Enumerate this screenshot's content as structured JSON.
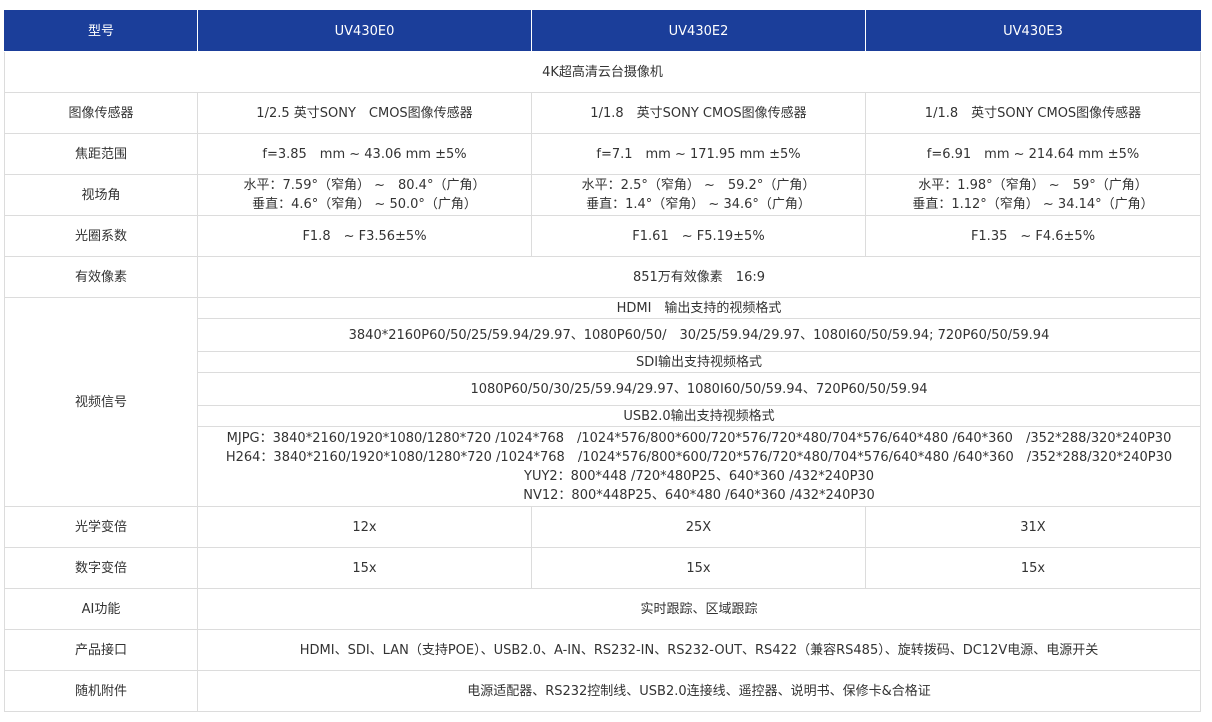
{
  "header": {
    "col_label": "型号",
    "models": [
      "UV430E0",
      "UV430E2",
      "UV430E3"
    ]
  },
  "title_row": "4K超高清云台摄像机",
  "sensor": {
    "label": "图像传感器",
    "values": [
      "1/2.5 英寸SONY　CMOS图像传感器",
      "1/1.8　英寸SONY CMOS图像传感器",
      "1/1.8　英寸SONY CMOS图像传感器"
    ]
  },
  "focal": {
    "label": "焦距范围",
    "values": [
      "f=3.85　mm ~ 43.06 mm ±5%",
      "f=7.1　mm ~ 171.95 mm ±5%",
      "f=6.91　mm ~ 214.64 mm ±5%"
    ]
  },
  "fov": {
    "label": "视场角",
    "values": [
      {
        "h": "水平：7.59°（窄角） ~　80.4°（广角）",
        "v": "垂直：4.6°（窄角） ~ 50.0°（广角）"
      },
      {
        "h": "水平：2.5°（窄角） ~　59.2°（广角）",
        "v": "垂直：1.4°（窄角） ~ 34.6°（广角）"
      },
      {
        "h": "水平：1.98°（窄角） ~　59°（广角）",
        "v": "垂直：1.12°（窄角） ~ 34.14°（广角）"
      }
    ]
  },
  "aperture": {
    "label": "光圈系数",
    "values": [
      "F1.8　~ F3.56±5%",
      "F1.61　~ F5.19±5%",
      "F1.35　~ F4.6±5%"
    ]
  },
  "pixels": {
    "label": "有效像素",
    "value": "851万有效像素　16:9"
  },
  "video": {
    "label": "视频信号",
    "hdmi_title": "HDMI　输出支持的视频格式",
    "hdmi_formats": "3840*2160P60/50/25/59.94/29.97、1080P60/50/　30/25/59.94/29.97、1080I60/50/59.94; 720P60/50/59.94",
    "sdi_title": "SDI输出支持视频格式",
    "sdi_formats": "1080P60/50/30/25/59.94/29.97、1080I60/50/59.94、720P60/50/59.94",
    "usb_title": "USB2.0输出支持视频格式",
    "usb_lines": [
      "MJPG：3840*2160/1920*1080/1280*720 /1024*768　/1024*576/800*600/720*576/720*480/704*576/640*480 /640*360　/352*288/320*240P30",
      "H264：3840*2160/1920*1080/1280*720 /1024*768　/1024*576/800*600/720*576/720*480/704*576/640*480 /640*360　/352*288/320*240P30",
      "YUY2：800*448 /720*480P25、640*360 /432*240P30",
      "NV12：800*448P25、640*480 /640*360 /432*240P30"
    ]
  },
  "optical_zoom": {
    "label": "光学变倍",
    "values": [
      "12x",
      "25X",
      "31X"
    ]
  },
  "digital_zoom": {
    "label": "数字变倍",
    "values": [
      "15x",
      "15x",
      "15x"
    ]
  },
  "ai": {
    "label": "AI功能",
    "value": "实时跟踪、区域跟踪"
  },
  "interfaces": {
    "label": "产品接口",
    "value": "HDMI、SDI、LAN（支持POE）、USB2.0、A-IN、RS232-IN、RS232-OUT、RS422（兼容RS485）、旋转拨码、DC12V电源、电源开关"
  },
  "accessories": {
    "label": "随机附件",
    "value": "电源适配器、RS232控制线、USB2.0连接线、遥控器、说明书、保修卡&合格证"
  },
  "colors": {
    "header_bg": "#1b3e9a",
    "header_text": "#ffffff",
    "border": "#dcdcdc",
    "text": "#333333"
  }
}
